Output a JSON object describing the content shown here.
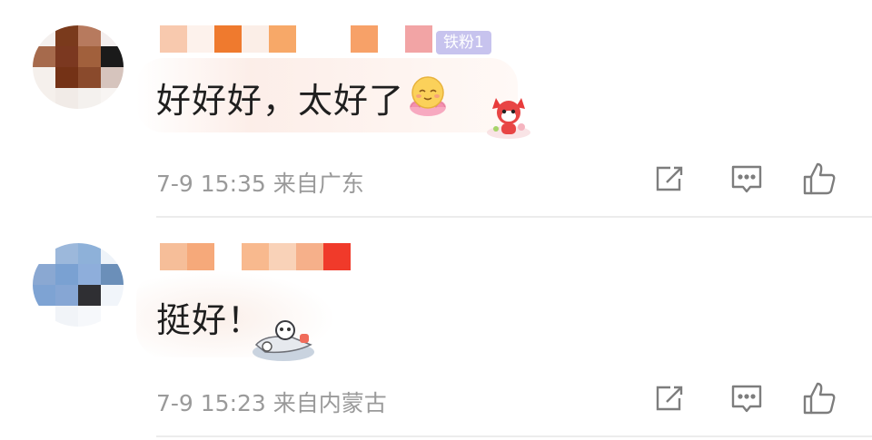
{
  "comments": [
    {
      "text": "好好好，太好了",
      "timestamp": "7-9 15:35",
      "location": "来自广东",
      "fan_badge": "铁粉1",
      "avatar_colors": [
        "#f4f0ee",
        "#7a3a1c",
        "#b77a5e",
        "#f3eeee",
        "#a66a4c",
        "#7b3820",
        "#a1603c",
        "#1a1a1a",
        "#f5f0ec",
        "#743216",
        "#8a4a2c",
        "#d6c4bd",
        "#f5f0ec",
        "#f1ebe7",
        "#f4f1ee",
        "#f8f5f3"
      ],
      "name_mosaic_colors": [
        "#f8c9ae",
        "#fdf2ec",
        "#ef7a2e",
        "#fbeee7",
        "#f7a868",
        "#ffffff",
        "#ffffff",
        "#f7a168",
        "#ffffff",
        "#f2a4a5"
      ]
    },
    {
      "text": "挺好！",
      "timestamp": "7-9 15:23",
      "location": "来自内蒙古",
      "avatar_colors": [
        "#ffffff",
        "#9cb8db",
        "#8eb1d9",
        "#eef3f9",
        "#8aa8d2",
        "#7aa1d2",
        "#8eaedb",
        "#6b8fb9",
        "#7ea3d3",
        "#86a6d4",
        "#2f2f33",
        "#f1f5fa",
        "#ffffff",
        "#f1f4f8",
        "#f6f8fb",
        "#ffffff"
      ],
      "name_mosaic_colors": [
        "#f6be99",
        "#f6a97a",
        "#ffffff",
        "#f8b98e",
        "#f9d2b8",
        "#f6b08a",
        "#f03a2a"
      ]
    }
  ],
  "icons": {
    "share": "share-icon",
    "reply": "comment-icon",
    "like": "thumbs-up-icon"
  },
  "colors": {
    "meta_text": "#9a9a9a",
    "body_text": "#1f1f1f",
    "icon_stroke": "#7d7d7d",
    "badge_bg": "#c7c3ee"
  }
}
